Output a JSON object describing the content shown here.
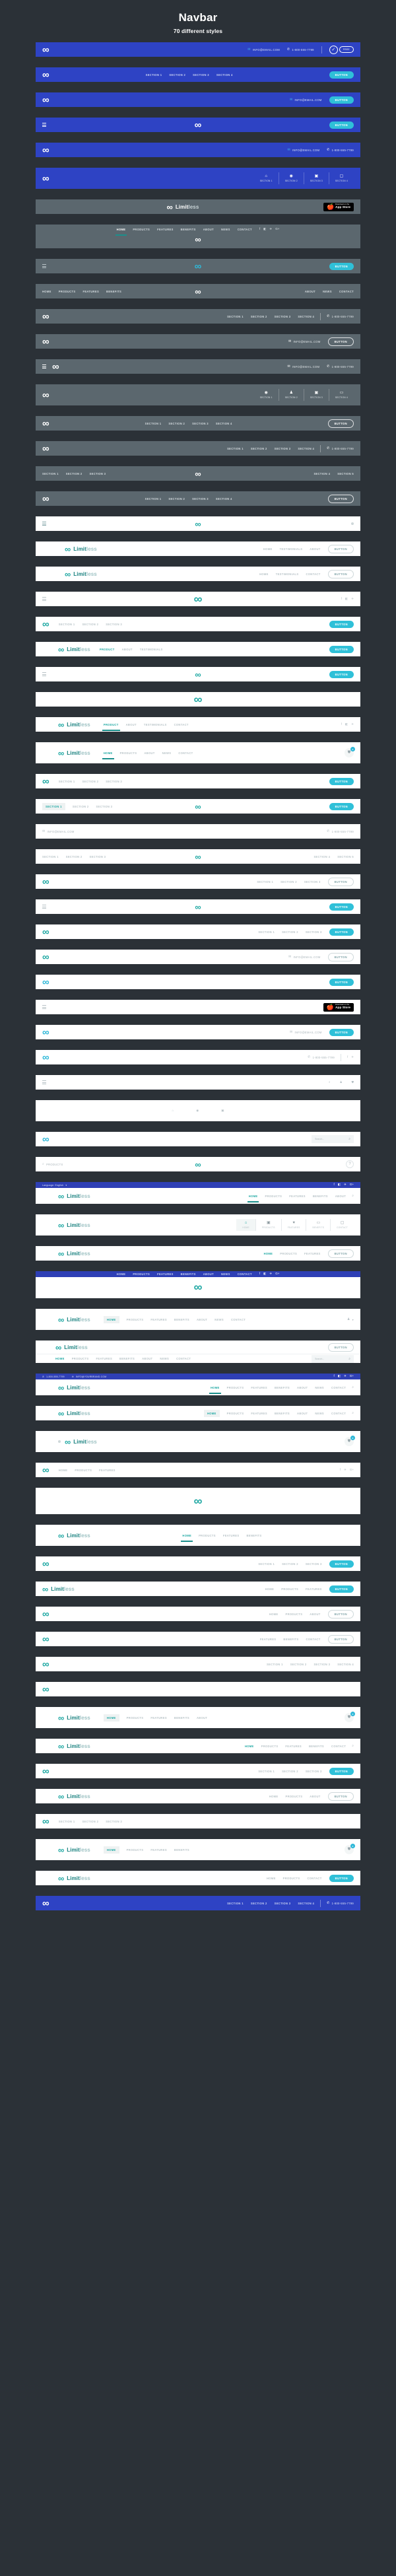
{
  "header": {
    "title": "Navbar",
    "subtitle": "70 different styles"
  },
  "brand": {
    "part1": "Limit",
    "part2": "less",
    "logo_icon": "infinity-logo-icon"
  },
  "common": {
    "email": "INFO@EMAIL.COM",
    "email_alt": "INFO@YOURBRAND.COM",
    "phone": "1-800-555-7799",
    "button": "BUTTON",
    "search_placeholder": "Search...",
    "language_label": "Language: English",
    "appstore_pre": "Download on the",
    "appstore_name": "App Store",
    "free_label": "FREE",
    "cart_count": "0"
  },
  "sections": [
    "SECTION 1",
    "SECTION 2",
    "SECTION 3",
    "SECTION 4",
    "SECTION 5"
  ],
  "menu": [
    "HOME",
    "PRODUCTS",
    "FEATURES",
    "BENEFITS",
    "ABOUT",
    "NEWS",
    "CONTACT"
  ],
  "menu_short": [
    "HOME",
    "PRODUCT",
    "ABOUT",
    "TESTIMONIALS",
    "CONTACT"
  ],
  "icons": {
    "email": "✉",
    "phone": "✆",
    "search": "⌕",
    "home": "⌂",
    "globe": "◉",
    "user": "♟",
    "camera": "▣",
    "lock": "⌂",
    "cart": "⛊",
    "heart": "♥",
    "truck": "▭",
    "bag": "▢",
    "facebook": "f",
    "twitter": "✈",
    "google": "G+",
    "rss": "◧",
    "apple": "",
    "chevron": "▾",
    "check": "✓"
  },
  "social": [
    "f",
    "◧",
    "✈",
    "G+"
  ]
}
